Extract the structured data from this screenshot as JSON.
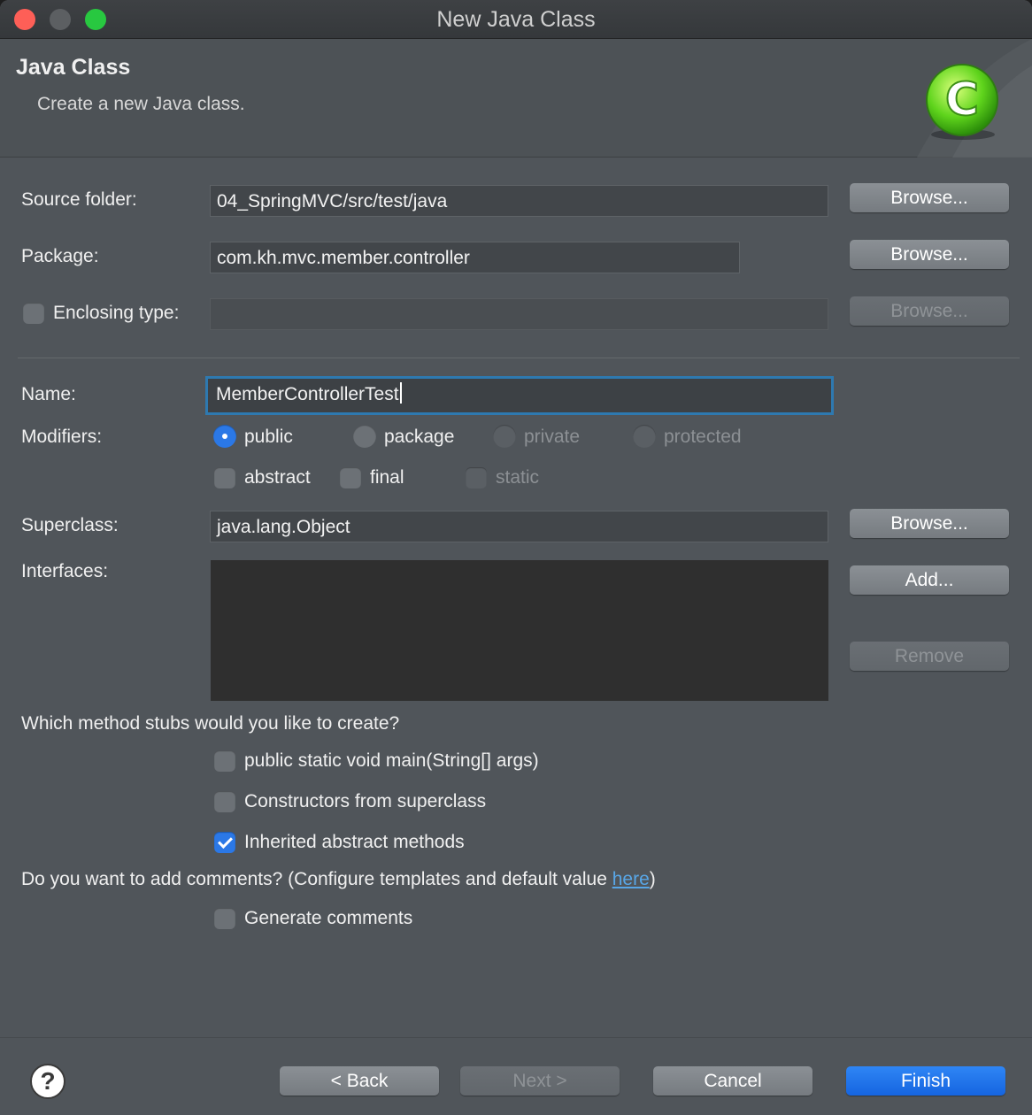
{
  "window": {
    "title": "New Java Class"
  },
  "banner": {
    "title": "Java Class",
    "description": "Create a new Java class.",
    "icon": "java-class-c-icon",
    "icon_letter": "C"
  },
  "source_folder": {
    "label": "Source folder:",
    "value": "04_SpringMVC/src/test/java",
    "browse_label": "Browse..."
  },
  "package": {
    "label": "Package:",
    "value": "com.kh.mvc.member.controller",
    "browse_label": "Browse..."
  },
  "enclosing_type": {
    "label": "Enclosing type:",
    "checked": false,
    "value": "",
    "browse_label": "Browse..."
  },
  "name": {
    "label": "Name:",
    "value": "MemberControllerTest"
  },
  "modifiers": {
    "label": "Modifiers:",
    "access": [
      {
        "label": "public",
        "selected": true,
        "enabled": true
      },
      {
        "label": "package",
        "selected": false,
        "enabled": true
      },
      {
        "label": "private",
        "selected": false,
        "enabled": false
      },
      {
        "label": "protected",
        "selected": false,
        "enabled": false
      }
    ],
    "flags": [
      {
        "label": "abstract",
        "checked": false,
        "enabled": true
      },
      {
        "label": "final",
        "checked": false,
        "enabled": true
      },
      {
        "label": "static",
        "checked": false,
        "enabled": false
      }
    ]
  },
  "superclass": {
    "label": "Superclass:",
    "value": "java.lang.Object",
    "browse_label": "Browse..."
  },
  "interfaces": {
    "label": "Interfaces:",
    "add_label": "Add...",
    "remove_label": "Remove"
  },
  "method_stubs": {
    "question": "Which method stubs would you like to create?",
    "options": [
      {
        "label": "public static void main(String[] args)",
        "checked": false
      },
      {
        "label": "Constructors from superclass",
        "checked": false
      },
      {
        "label": "Inherited abstract methods",
        "checked": true
      }
    ]
  },
  "comments": {
    "question_prefix": "Do you want to add comments? (Configure templates and default value ",
    "link_text": "here",
    "question_suffix": ")",
    "generate_label": "Generate comments",
    "generate_checked": false
  },
  "footer": {
    "help_symbol": "?",
    "back_label": "< Back",
    "next_label": "Next >",
    "cancel_label": "Cancel",
    "finish_label": "Finish"
  },
  "colors": {
    "accent": "#1565e0",
    "focus_ring": "#2e79b0",
    "link": "#58a6e6",
    "close": "#fe5f57",
    "maximize": "#28c840"
  }
}
